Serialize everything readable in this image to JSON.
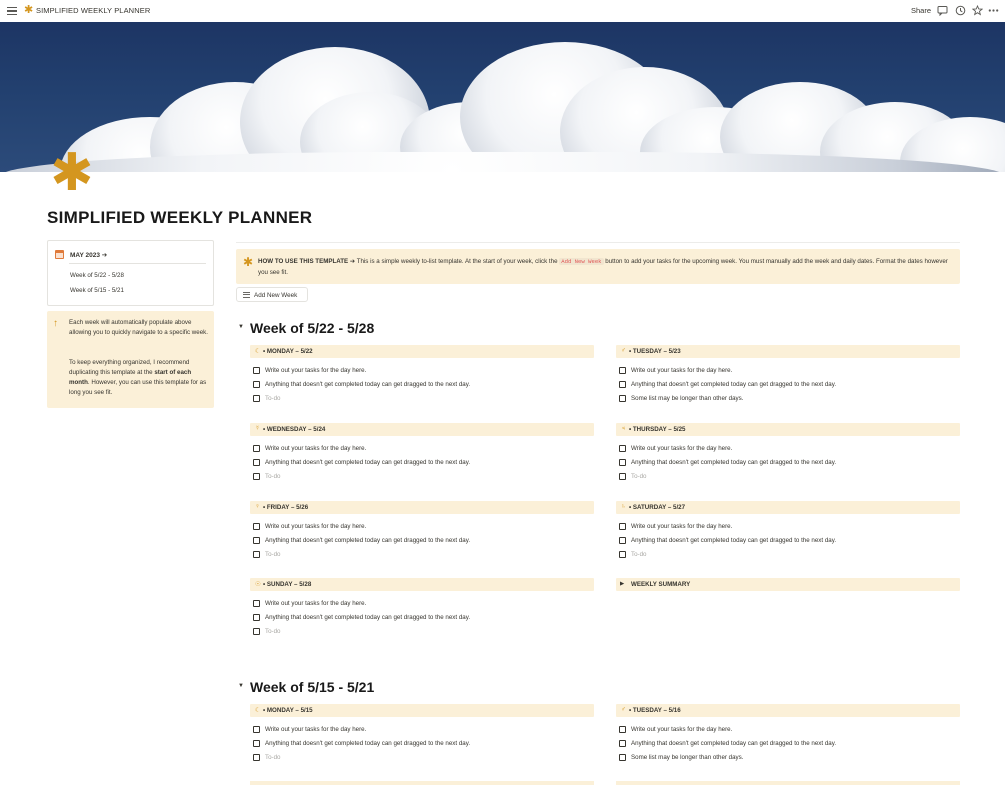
{
  "topbar": {
    "page_icon": "asterisk-icon",
    "breadcrumb": "SIMPLIFIED WEEKLY PLANNER",
    "share_label": "Share",
    "icons": [
      "comment-icon",
      "history-icon",
      "star-icon",
      "more-icon"
    ]
  },
  "cover": {
    "description_icon": "cloud-cover-image"
  },
  "page": {
    "icon": "✱",
    "title": "SIMPLIFIED WEEKLY PLANNER"
  },
  "nav": {
    "month": "MAY 2023 ➔",
    "links": [
      "Week of 5/22 - 5/28",
      "Week of 5/15 - 5/21"
    ]
  },
  "note": {
    "para1": "Each week will automatically populate above allowing you to quickly navigate to a specific week.",
    "para2_a": "To keep everything organized, I recommend duplicating this template at the ",
    "para2_bold": "start of each month",
    "para2_b": ". However, you can use this template for as long you see fit."
  },
  "howto": {
    "bold": "HOW TO USE THIS TEMPLATE ➔",
    "text_a": " This is a simple weekly to-list template. At the start of your week, click the ",
    "code": "Add New Week",
    "text_b": " button to add your tasks for the upcoming week. You must manually add the week and daily dates. Format the dates however you see fit."
  },
  "add_button": "Add New Week",
  "tasks": {
    "t1": "Write out your tasks for the day here.",
    "t2": "Anything that doesn't get completed today can get dragged to the next day.",
    "t3": "Some list may be longer than other days.",
    "placeholder": "To-do"
  },
  "weeks": [
    {
      "title": "Week of 5/22 - 5/28",
      "days": [
        {
          "label": "• MONDAY – 5/22",
          "icon": "☾"
        },
        {
          "label": "• TUESDAY – 5/23",
          "icon": "♂"
        },
        {
          "label": "• WEDNESDAY – 5/24",
          "icon": "☿"
        },
        {
          "label": "• THURSDAY – 5/25",
          "icon": "♃"
        },
        {
          "label": "• FRIDAY – 5/26",
          "icon": "♀"
        },
        {
          "label": "• SATURDAY – 5/27",
          "icon": "♄"
        },
        {
          "label": "• SUNDAY – 5/28",
          "icon": "☉"
        }
      ],
      "summary": "WEEKLY SUMMARY"
    },
    {
      "title": "Week of 5/15 - 5/21",
      "days": [
        {
          "label": "• MONDAY – 5/15",
          "icon": "☾"
        },
        {
          "label": "• TUESDAY – 5/16",
          "icon": "♂"
        }
      ]
    }
  ],
  "colors": {
    "accent": "#d4961f",
    "callout_bg": "#fbf0d8",
    "cover_sky": "#1d3564",
    "code_text": "#e05555"
  }
}
